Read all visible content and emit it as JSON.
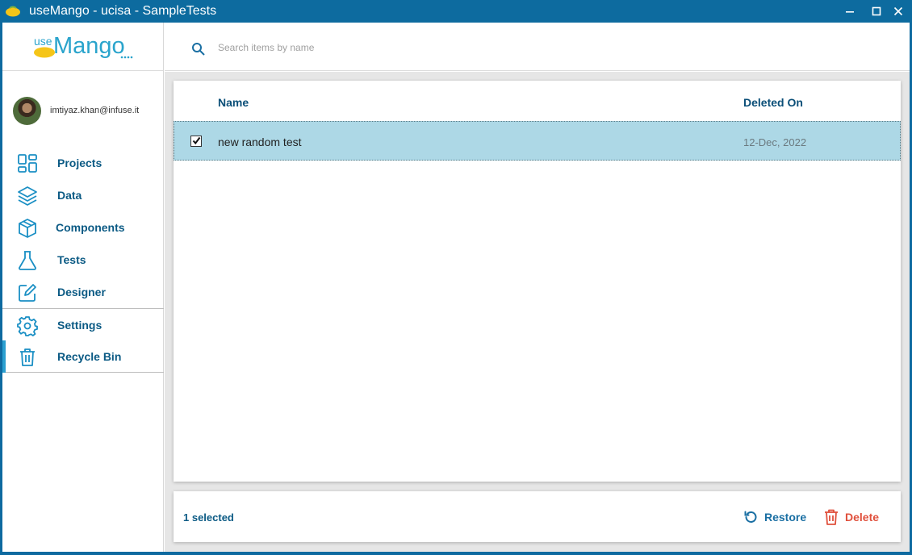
{
  "window": {
    "title": "useMango - ucisa - SampleTests",
    "accent_color": "#0d6b9f"
  },
  "logo": {
    "prefix": "use",
    "brand": "Mango",
    "brand_color": "#2aa4cc"
  },
  "user": {
    "email": "imtiyaz.khan@infuse.it"
  },
  "sidebar": {
    "items": [
      {
        "label": "Projects",
        "icon": "grid-icon"
      },
      {
        "label": "Data",
        "icon": "layers-icon"
      },
      {
        "label": "Components",
        "icon": "cube-icon"
      },
      {
        "label": "Tests",
        "icon": "flask-icon"
      },
      {
        "label": "Designer",
        "icon": "edit-icon"
      },
      {
        "label": "Settings",
        "icon": "gear-icon"
      },
      {
        "label": "Recycle Bin",
        "icon": "trash-icon",
        "active": true
      }
    ]
  },
  "search": {
    "placeholder": "Search items by name",
    "value": ""
  },
  "table": {
    "columns": [
      "Name",
      "Deleted On"
    ],
    "rows": [
      {
        "name": "new random test",
        "deleted_on": "12-Dec, 2022",
        "selected": true
      }
    ],
    "selected_row_color": "#add8e6"
  },
  "footer": {
    "selected_text": "1 selected",
    "restore_label": "Restore",
    "delete_label": "Delete",
    "delete_color": "#e0503c"
  }
}
